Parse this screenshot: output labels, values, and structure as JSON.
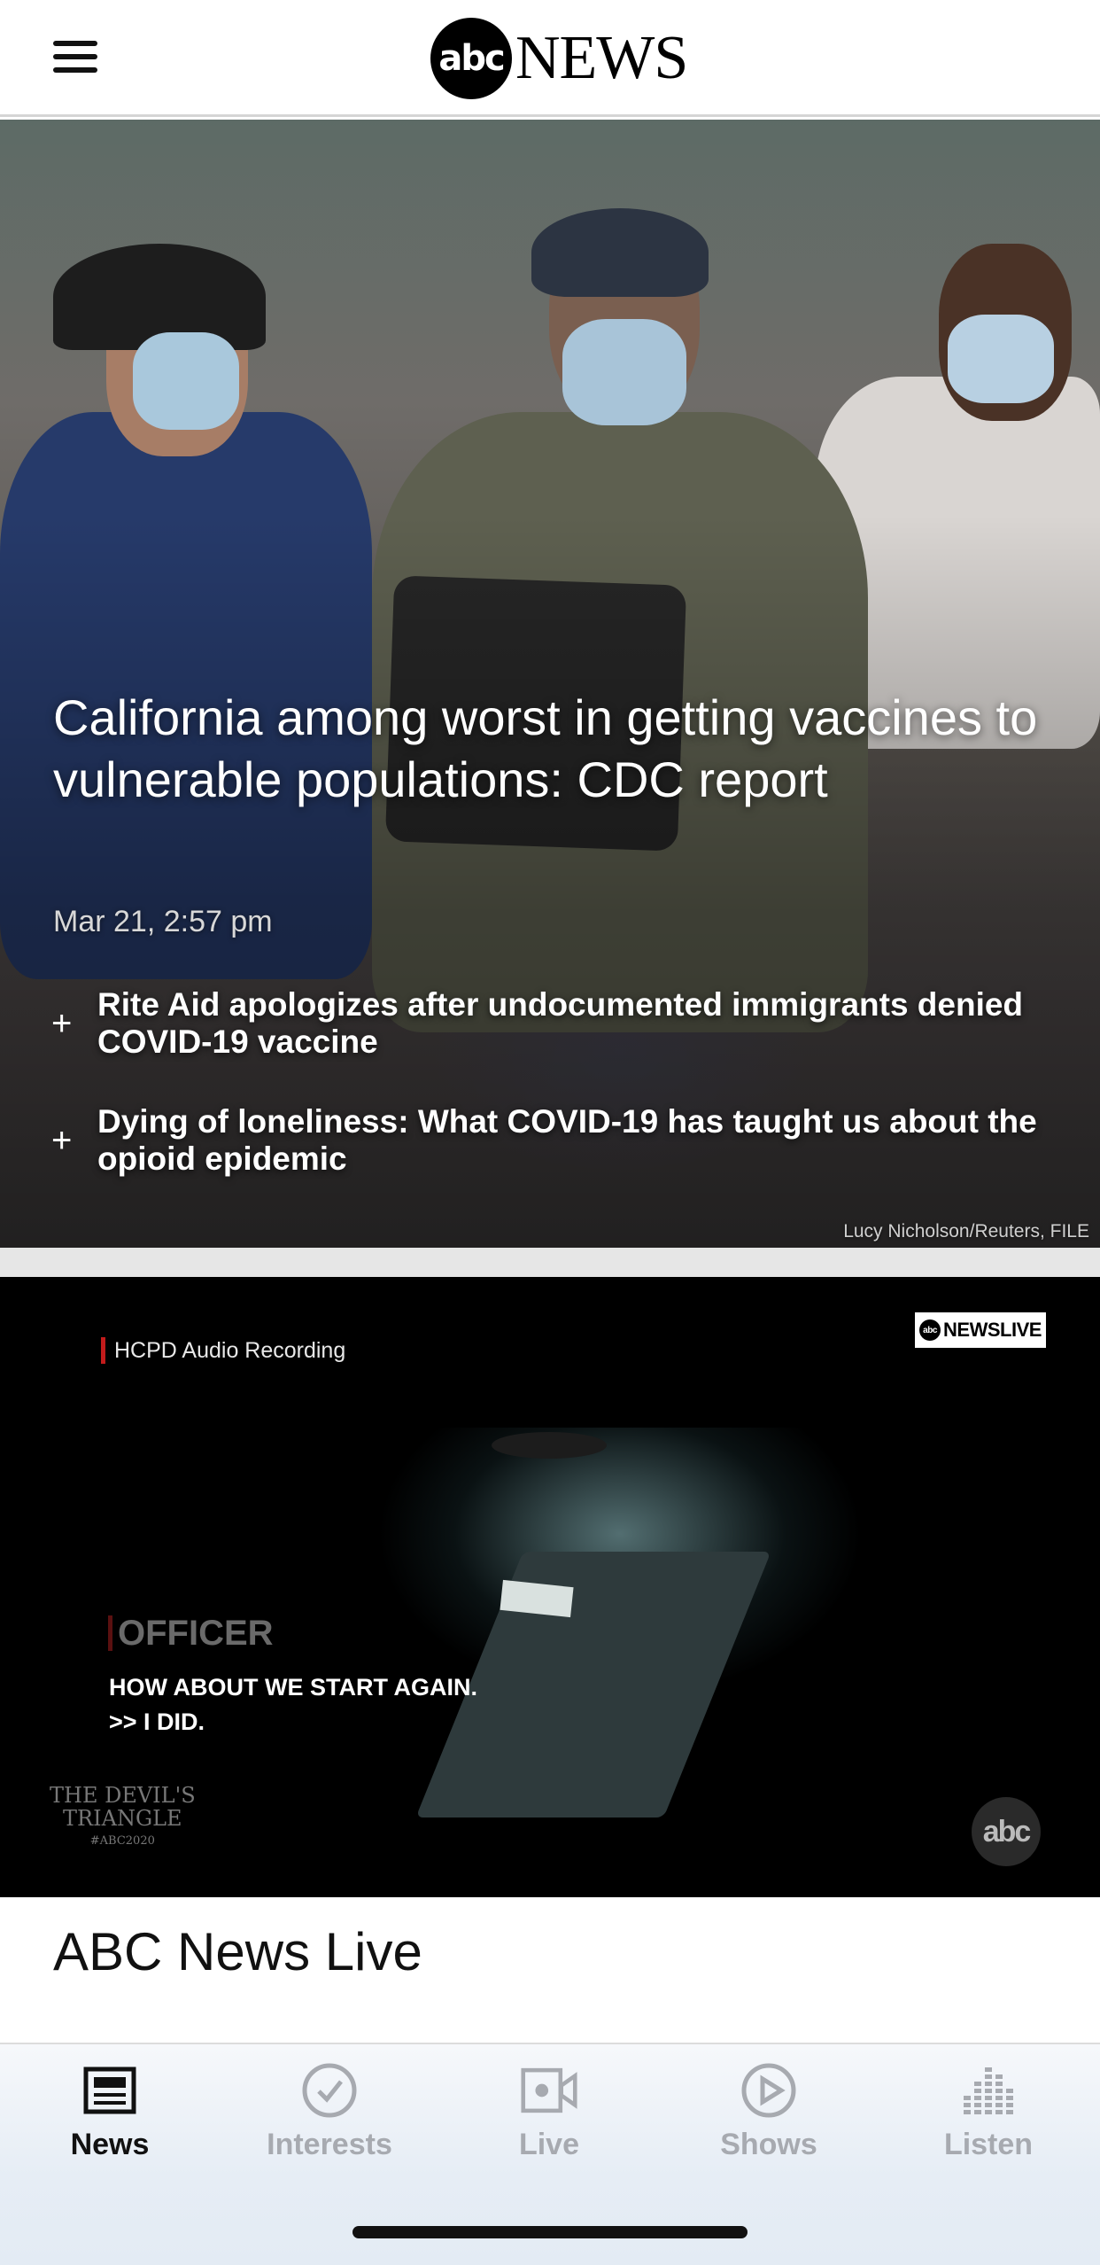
{
  "header": {
    "logo_circle": "abc",
    "logo_word": "NEWS"
  },
  "hero": {
    "headline": "California among worst in getting vaccines to vulnerable populations: CDC report",
    "date": "Mar 21, 2:57 pm",
    "related": [
      {
        "text": "Rite Aid apologizes after undocumented immigrants denied COVID-19 vaccine"
      },
      {
        "text": "Dying of loneliness: What COVID-19 has taught us about the opioid epidemic"
      }
    ],
    "credit": "Lucy Nicholson/Reuters, FILE"
  },
  "video": {
    "chip": "HCPD Audio Recording",
    "live_logo_word": "NEWS",
    "live_logo_suffix": "LIVE",
    "officer_label": "OFFICER",
    "caption_line1": "HOW ABOUT WE START AGAIN.",
    "caption_line2": ">> I DID.",
    "show_logo_line1": "THE DEVIL'S",
    "show_logo_line2": "TRIANGLE",
    "show_logo_tag": "#ABC2020",
    "bug_text": "abc"
  },
  "section": {
    "title": "ABC News Live"
  },
  "tabs": [
    {
      "label": "News",
      "icon": "newspaper-icon",
      "active": true
    },
    {
      "label": "Interests",
      "icon": "checkmark-circle-icon",
      "active": false
    },
    {
      "label": "Live",
      "icon": "video-camera-icon",
      "active": false
    },
    {
      "label": "Shows",
      "icon": "play-circle-icon",
      "active": false
    },
    {
      "label": "Listen",
      "icon": "audio-bars-icon",
      "active": false
    }
  ],
  "colors": {
    "active_tab": "#111111",
    "inactive_tab": "#a7aab0",
    "chip_accent": "#c21b1b"
  }
}
